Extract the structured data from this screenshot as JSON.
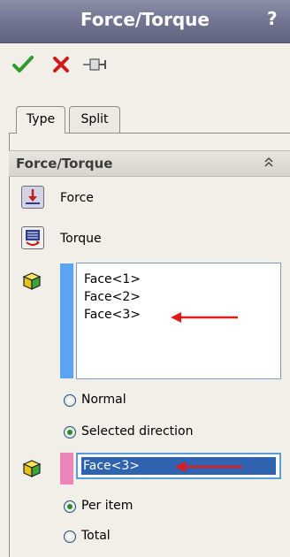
{
  "window": {
    "title": "Force/Torque",
    "help": "?"
  },
  "toolbar": {
    "ok_icon": "checkmark-icon",
    "cancel_icon": "x-icon",
    "pin_icon": "pushpin-icon"
  },
  "tabs": [
    {
      "label": "Type",
      "active": true
    },
    {
      "label": "Split",
      "active": false
    }
  ],
  "section": {
    "title": "Force/Torque",
    "collapse_glyph": "«"
  },
  "types": [
    {
      "label": "Force",
      "icon": "force-icon"
    },
    {
      "label": "Torque",
      "icon": "torque-icon"
    }
  ],
  "faces_list": {
    "items": [
      "Face<1>",
      "Face<2>",
      "Face<3>"
    ]
  },
  "direction": {
    "options": [
      {
        "label": "Normal",
        "selected": false
      },
      {
        "label": "Selected direction",
        "selected": true
      }
    ]
  },
  "direction_ref": {
    "value": "Face<3>"
  },
  "distribution": {
    "options": [
      {
        "label": "Per item",
        "selected": true
      },
      {
        "label": "Total",
        "selected": false
      }
    ]
  },
  "colors": {
    "title_bar": "#6f7390",
    "arrow": "#e01b1b",
    "list_strip": "#5aa4f1",
    "ref_strip": "#ec85b8",
    "selection": "#2f63b0"
  }
}
